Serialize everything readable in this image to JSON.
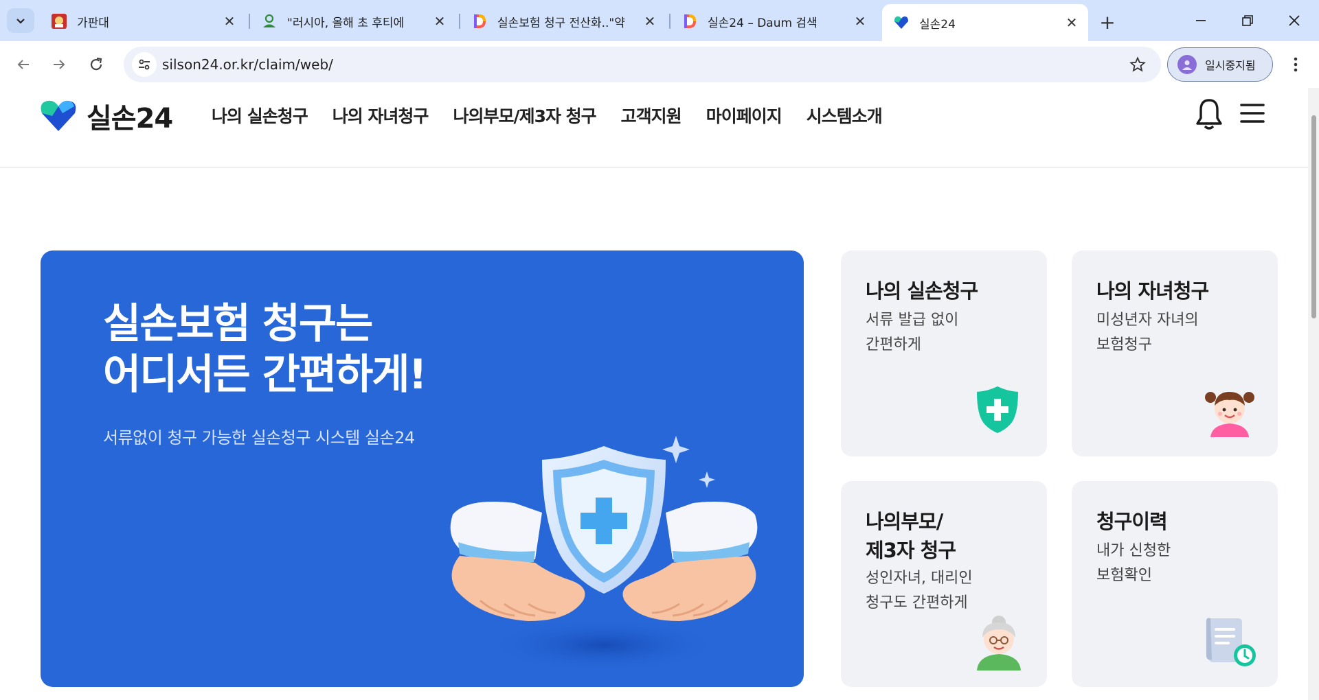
{
  "browser": {
    "tabs": [
      {
        "title": "가판대",
        "active": false
      },
      {
        "title": "\"러시아, 올해 초 후티에",
        "active": false
      },
      {
        "title": "실손보험 청구 전산화..\"약",
        "active": false
      },
      {
        "title": "실손24 – Daum 검색",
        "active": false
      },
      {
        "title": "실손24",
        "active": true
      }
    ],
    "url": "silson24.or.kr/claim/web/",
    "profile_label": "일시중지됨"
  },
  "site": {
    "logo_text": "실손24",
    "nav": [
      "나의 실손청구",
      "나의 자녀청구",
      "나의부모/제3자 청구",
      "고객지원",
      "마이페이지",
      "시스템소개"
    ]
  },
  "hero": {
    "title_line1": "실손보험 청구는",
    "title_line2": "어디서든 간편하게!",
    "subtitle": "서류없이 청구 가능한 실손청구 시스템 실손24"
  },
  "cards": [
    {
      "title": "나의 실손청구",
      "desc1": "서류 발급 없이",
      "desc2": "간편하게",
      "icon": "medical-shield-icon"
    },
    {
      "title": "나의 자녀청구",
      "desc1": "미성년자 자녀의",
      "desc2": "보험청구",
      "icon": "child-avatar-icon"
    },
    {
      "title_line1": "나의부모/",
      "title_line2": "제3자 청구",
      "desc1": "성인자녀, 대리인",
      "desc2": "청구도 간편하게",
      "icon": "grandmother-avatar-icon"
    },
    {
      "title": "청구이력",
      "desc1": "내가 신청한",
      "desc2": "보험확인",
      "icon": "document-clock-icon"
    }
  ],
  "colors": {
    "hero_bg": "#2767d8",
    "card_bg": "#f1f2f6",
    "brand_green": "#14c59d",
    "tabstrip_bg": "#d3e3fd"
  }
}
